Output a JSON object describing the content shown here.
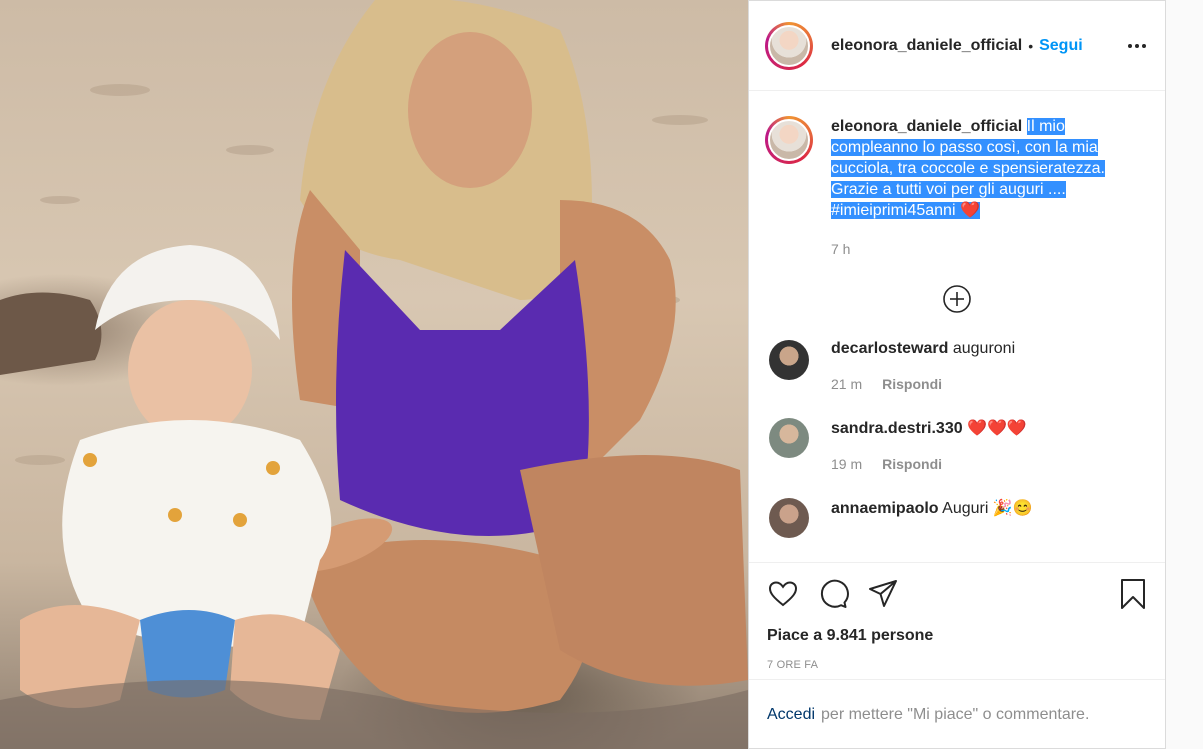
{
  "post": {
    "username": "eleonora_daniele_official",
    "follow_label": "Segui",
    "dot": "•",
    "caption_lines": [
      "Il mio",
      "compleanno lo passo così, con la mia",
      "cucciola, tra coccole e spensieratezza.",
      "Grazie a tutti voi per gli auguri ....",
      "#imieiprimi45anni ❤️"
    ],
    "caption_time": "7 h",
    "likes": "Piace a 9.841 persone",
    "posted_ago": "7 ORE FA"
  },
  "comments": [
    {
      "user": "decarlosteward",
      "text": "auguroni",
      "time": "21 m",
      "reply": "Rispondi"
    },
    {
      "user": "sandra.destri.330",
      "text": "❤️❤️❤️",
      "time": "19 m",
      "reply": "Rispondi"
    },
    {
      "user": "annaemipaolo",
      "text": "Auguri 🎉😊",
      "time": "",
      "reply": ""
    }
  ],
  "login_prompt": {
    "link": "Accedi",
    "rest": "per mettere \"Mi piace\" o commentare."
  },
  "icons": {
    "more": "more-options-icon",
    "add": "add-comment-icon",
    "like": "heart-icon",
    "comment": "comment-icon",
    "share": "share-icon",
    "save": "bookmark-icon"
  },
  "colors": {
    "follow": "#0095f6",
    "text": "#262626",
    "muted": "#8e8e8e",
    "selection": "#3390ff",
    "link": "#00376b"
  }
}
